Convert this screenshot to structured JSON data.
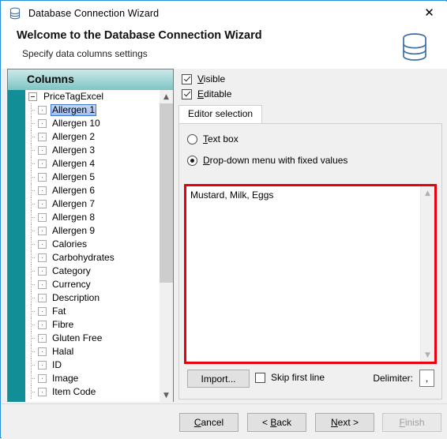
{
  "window": {
    "title": "Database Connection Wizard",
    "title_icon": "database-icon",
    "close_icon": "close-icon"
  },
  "header": {
    "title": "Welcome to the Database Connection Wizard",
    "subtitle": "Specify data columns settings",
    "icon": "database-icon"
  },
  "columns_panel": {
    "header_label": "Columns",
    "root_label": "PriceTagExcel",
    "items": [
      {
        "label": "Allergen 1",
        "selected": true,
        "checked": false
      },
      {
        "label": "Allergen 10",
        "selected": false,
        "checked": false
      },
      {
        "label": "Allergen 2",
        "selected": false,
        "checked": false
      },
      {
        "label": "Allergen 3",
        "selected": false,
        "checked": false
      },
      {
        "label": "Allergen 4",
        "selected": false,
        "checked": false
      },
      {
        "label": "Allergen 5",
        "selected": false,
        "checked": false
      },
      {
        "label": "Allergen 6",
        "selected": false,
        "checked": false
      },
      {
        "label": "Allergen 7",
        "selected": false,
        "checked": false
      },
      {
        "label": "Allergen 8",
        "selected": false,
        "checked": false
      },
      {
        "label": "Allergen 9",
        "selected": false,
        "checked": false
      },
      {
        "label": "Calories",
        "selected": false,
        "checked": false
      },
      {
        "label": "Carbohydrates",
        "selected": false,
        "checked": false
      },
      {
        "label": "Category",
        "selected": false,
        "checked": false
      },
      {
        "label": "Currency",
        "selected": false,
        "checked": false
      },
      {
        "label": "Description",
        "selected": false,
        "checked": false
      },
      {
        "label": "Fat",
        "selected": false,
        "checked": false
      },
      {
        "label": "Fibre",
        "selected": false,
        "checked": false
      },
      {
        "label": "Gluten Free",
        "selected": false,
        "checked": false
      },
      {
        "label": "Halal",
        "selected": false,
        "checked": false
      },
      {
        "label": "ID",
        "selected": false,
        "checked": false
      },
      {
        "label": "Image",
        "selected": false,
        "checked": false
      },
      {
        "label": "Item Code",
        "selected": false,
        "checked": false
      }
    ],
    "scrollbar": {
      "up_icon": "chevron-up-icon",
      "down_icon": "chevron-down-icon"
    }
  },
  "options": {
    "visible": {
      "label": "Visible",
      "accel": "V",
      "checked": true
    },
    "editable": {
      "label": "Editable",
      "accel": "E",
      "checked": true
    }
  },
  "tab": {
    "label": "Editor selection"
  },
  "editor_selection": {
    "text_box": {
      "label": "Text box",
      "accel": "T",
      "selected": false
    },
    "dropdown": {
      "label": "Drop-down menu with fixed values",
      "accel": "D",
      "selected": true
    },
    "values": "Mustard, Milk, Eggs",
    "values_highlight_color": "#e8000d",
    "scrollbar": {
      "up_icon": "chevron-up-icon",
      "down_icon": "chevron-down-icon"
    }
  },
  "import_row": {
    "import_label": "Import...",
    "skip_first_line": {
      "label": "Skip first line",
      "checked": false
    },
    "delimiter_label": "Delimiter:",
    "delimiter_value": ","
  },
  "footer": {
    "cancel": {
      "label": "Cancel",
      "accel": "C",
      "disabled": false
    },
    "back": {
      "label": "< Back",
      "accel": "B",
      "disabled": false
    },
    "next": {
      "label": "Next >",
      "accel": "N",
      "disabled": false
    },
    "finish": {
      "label": "Finish",
      "accel": "F",
      "disabled": true
    }
  },
  "colors": {
    "window_border": "#2a8fd4",
    "teal_bar": "#118e96",
    "panel_border": "#2e9c9c",
    "selection_blue": "#9ebdf0",
    "highlight_red": "#e8000d",
    "dialog_bg": "#f0f0f0"
  }
}
